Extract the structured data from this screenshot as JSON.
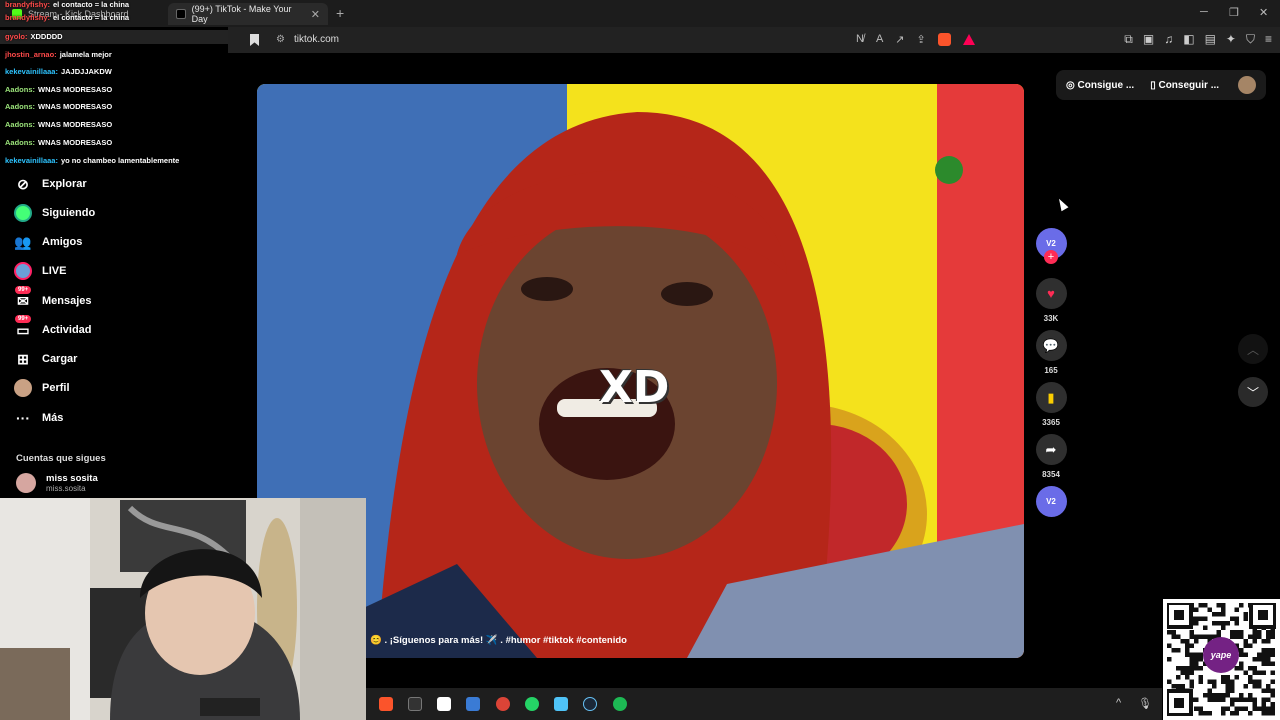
{
  "browser": {
    "tabs": [
      {
        "label": "Stream - Kick Dashboard",
        "active": false
      },
      {
        "label": "(99+) TikTok - Make Your Day",
        "active": true
      }
    ],
    "new_tab": "+",
    "window_controls": {
      "minimize": "─",
      "maximize": "❐",
      "close": "✕"
    },
    "url": "tiktok.com"
  },
  "chat": [
    {
      "user": "brandyfishy:",
      "text": "el contacto = la china",
      "color": "#ff4a4a"
    },
    {
      "user": "brandyfishy:",
      "text": "el contacto = la china",
      "color": "#ff4a4a"
    },
    {
      "user": "gyolo:",
      "text": "XDDDDD",
      "color": "#ff4a4a"
    },
    {
      "user": "jhostin_arnao:",
      "text": "jalamela mejor",
      "color": "#ff4a4a"
    },
    {
      "user": "kekevainillaaa:",
      "text": "JAJDJJAKDW",
      "color": "#2ec4ff"
    },
    {
      "user": "Aadons:",
      "text": "WNAS MODRESASO",
      "color": "#9be37a"
    },
    {
      "user": "Aadons:",
      "text": "WNAS MODRESASO",
      "color": "#9be37a"
    },
    {
      "user": "Aadons:",
      "text": "WNAS MODRESASO",
      "color": "#9be37a"
    },
    {
      "user": "Aadons:",
      "text": "WNAS MODRESASO",
      "color": "#9be37a"
    },
    {
      "user": "kekevainillaaa:",
      "text": "yo no chambeo lamentablemente",
      "color": "#2ec4ff"
    }
  ],
  "sidebar": {
    "items": [
      {
        "label": "Explorar",
        "icon": "compass-icon"
      },
      {
        "label": "Siguiendo",
        "icon": "avatar-icon"
      },
      {
        "label": "Amigos",
        "icon": "friends-icon"
      },
      {
        "label": "LIVE",
        "icon": "live-icon"
      },
      {
        "label": "Mensajes",
        "icon": "messages-icon",
        "badge": "99+"
      },
      {
        "label": "Actividad",
        "icon": "activity-icon",
        "badge": "99+"
      },
      {
        "label": "Cargar",
        "icon": "upload-icon"
      },
      {
        "label": "Perfil",
        "icon": "profile-icon"
      },
      {
        "label": "Más",
        "icon": "more-icon"
      }
    ],
    "following_title": "Cuentas que sigues",
    "following": [
      {
        "name": "miss sosita",
        "handle": "miss.sosita"
      }
    ]
  },
  "video": {
    "overlay_text": "XD",
    "caption": "😊 . ¡Síguenos para más! ✈️ . #humor #tiktok #contenido"
  },
  "actions": {
    "creator": "V2",
    "likes": "33K",
    "comments": "165",
    "saves": "3365",
    "shares": "8354"
  },
  "top_pill": {
    "get_coins": "Consigue ...",
    "get_app": "Conseguir ..."
  },
  "qr": {
    "logo_text": "yape"
  },
  "colors": {
    "accent": "#fe2c55",
    "save": "#facd00"
  }
}
